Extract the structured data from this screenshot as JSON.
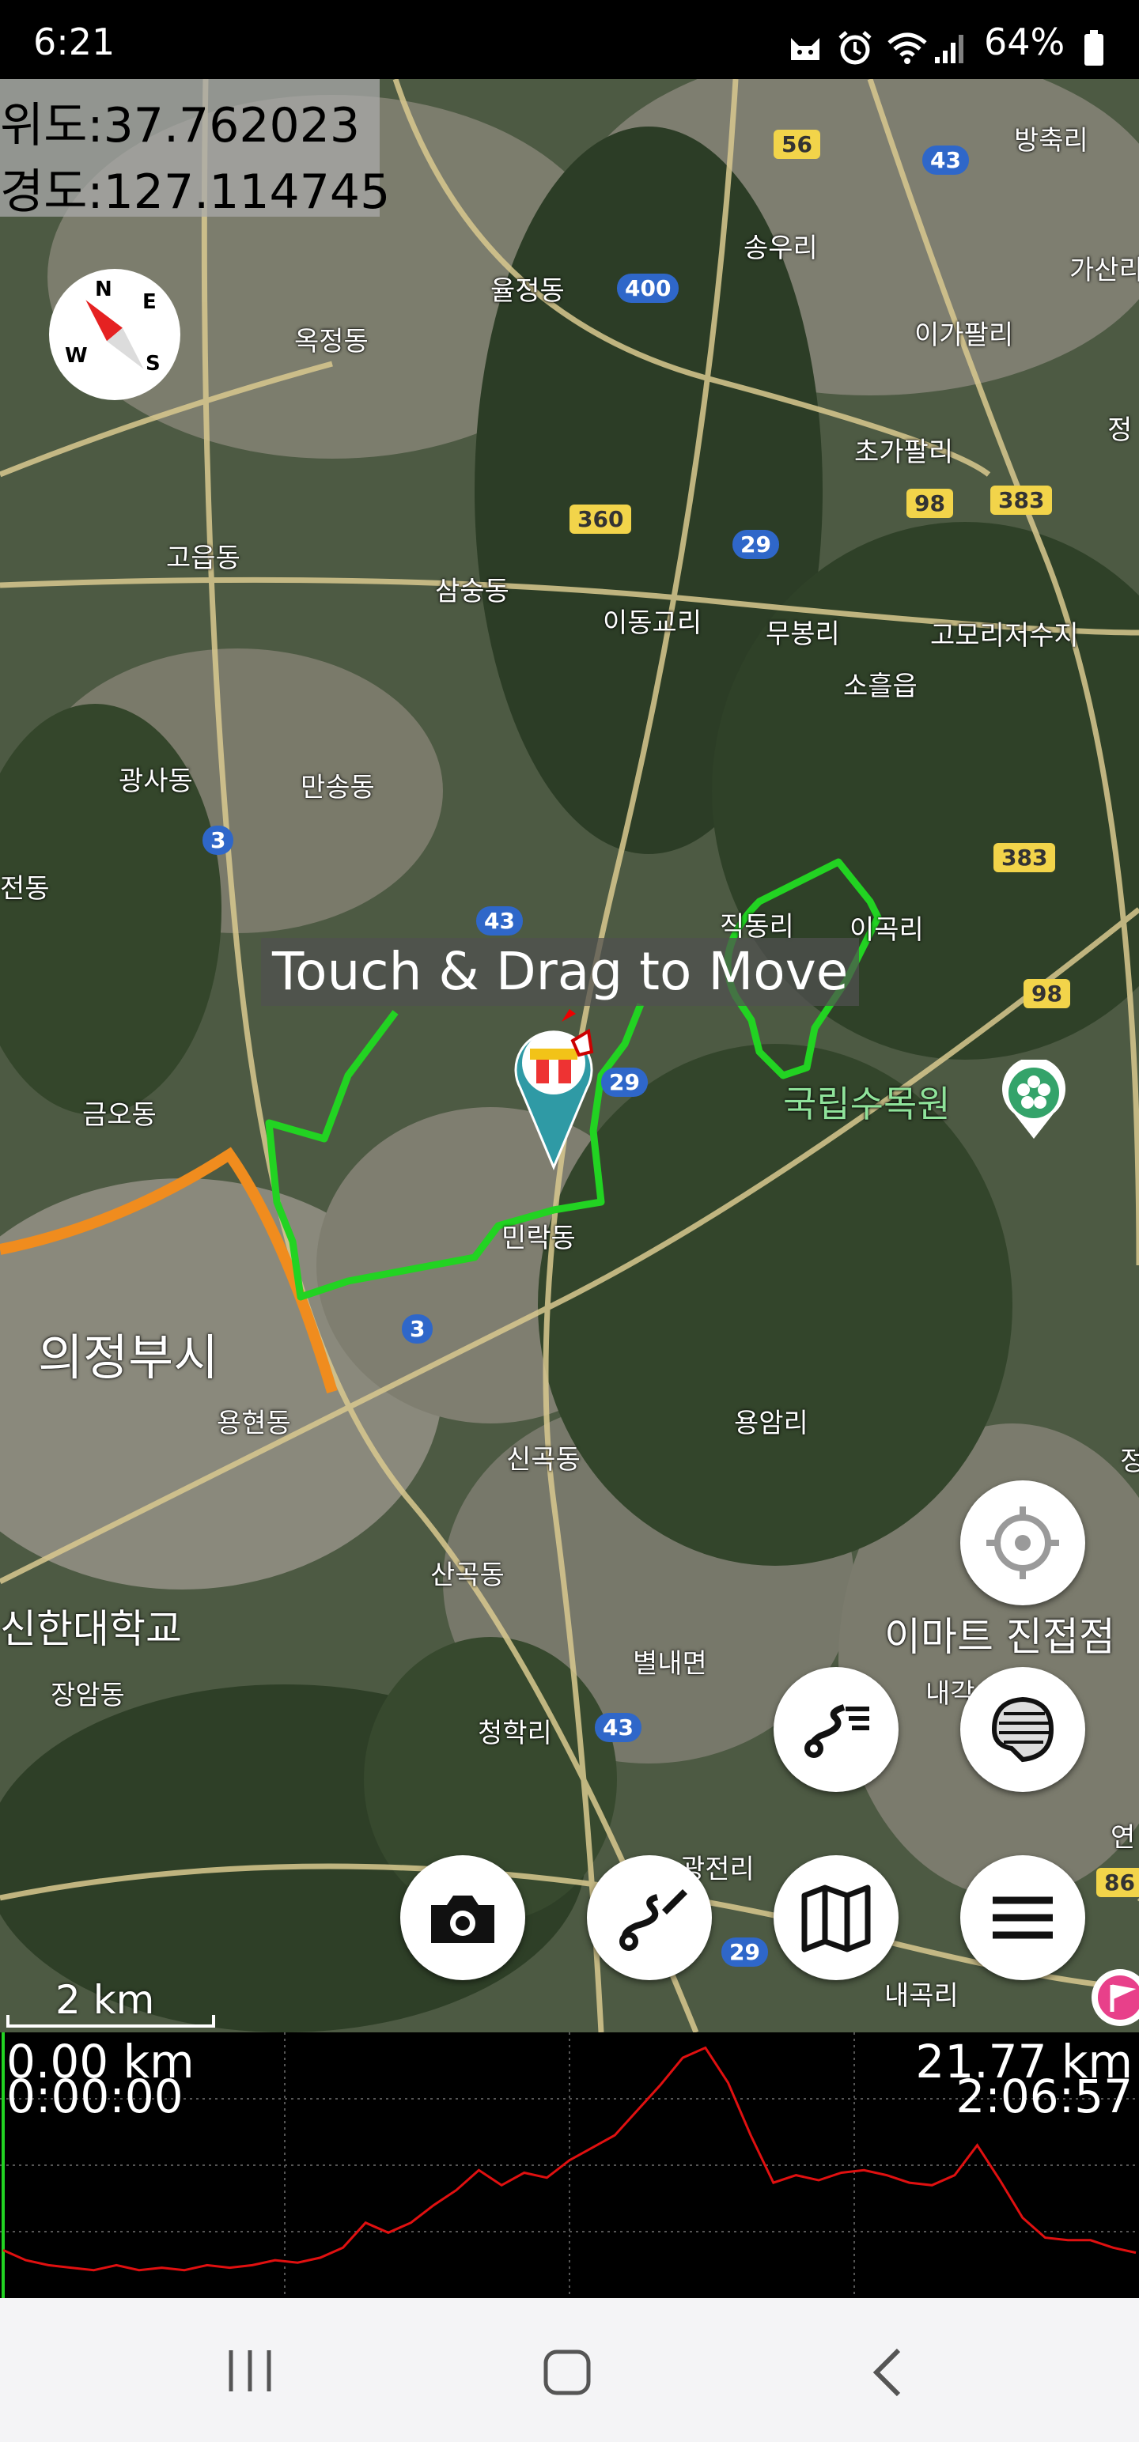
{
  "status_bar": {
    "time": "6:21",
    "battery_percent": "64%",
    "icons": [
      "cat-notification-icon",
      "alarm-icon",
      "wifi-icon",
      "signal-icon",
      "battery-icon"
    ]
  },
  "coordinates": {
    "latitude_text": "위도:37.762023",
    "longitude_text": "경도:127.114745"
  },
  "compass": {
    "north": "N",
    "east": "E",
    "south": "S",
    "west": "W"
  },
  "map": {
    "drag_hint": "Touch & Drag to Move",
    "place_labels": {
      "bangchukri": "방축리",
      "gasanri": "가산리",
      "yuljeongdong": "율정동",
      "songuri": "송우리",
      "okjeongdong": "옥정동",
      "igapalri": "이가팔리",
      "jeong": "정",
      "chogapalri": "초가팔리",
      "gosandong": "고읍동",
      "samsungdong": "삼숭동",
      "idonggyori": "이동교리",
      "mubongri": "무봉리",
      "gomorijeosuji": "고모리저수지",
      "soheulp": "소흘읍",
      "gwangsadong": "광사동",
      "mansongdong": "만송동",
      "jeondong": "전동",
      "jikdongri": "직동리",
      "igokri": "이곡리",
      "geumodong": "금오동",
      "arboretum": "국립수목원",
      "minrakdong": "민락동",
      "uijeongbu": "의정부시",
      "yonghyeondong": "용현동",
      "yongamri": "용암리",
      "singokdong": "신곡동",
      "sangokdong": "산곡동",
      "shinhan_univ": "신한대학교",
      "emart": "이마트 진접점",
      "naegak": "내각",
      "jangamdong": "장암동",
      "byeollaemyeon": "별내면",
      "cheonghakri": "청학리",
      "gwangjeonri": "광전리",
      "naegokri": "내곡리",
      "yeon": "연",
      "jeong2": "정"
    },
    "road_numbers": [
      "56",
      "43",
      "400",
      "360",
      "29",
      "98",
      "383",
      "3",
      "43",
      "383",
      "98",
      "29",
      "3",
      "43",
      "29",
      "86"
    ],
    "track_color": "#22d322",
    "road_highlight_color": "#f08c1e",
    "scale_label": "2 km"
  },
  "buttons": {
    "locate": "crosshair-icon",
    "route_list": "route-list-icon",
    "map_layer": "layer-icon",
    "camera": "camera-icon",
    "route_edit": "route-edit-icon",
    "map": "map-icon",
    "menu": "menu-icon"
  },
  "elevation_profile": {
    "start_distance": "0.00 km",
    "start_time": "0:00:00",
    "end_distance": "21.77 km",
    "end_time": "2:06:57",
    "line_color": "#e01010",
    "profile_fraction": [
      0.16,
      0.12,
      0.1,
      0.09,
      0.08,
      0.1,
      0.08,
      0.09,
      0.08,
      0.1,
      0.09,
      0.1,
      0.12,
      0.11,
      0.13,
      0.17,
      0.27,
      0.23,
      0.27,
      0.34,
      0.4,
      0.48,
      0.42,
      0.47,
      0.45,
      0.52,
      0.57,
      0.62,
      0.72,
      0.82,
      0.93,
      0.97,
      0.83,
      0.62,
      0.43,
      0.46,
      0.44,
      0.47,
      0.48,
      0.46,
      0.43,
      0.42,
      0.46,
      0.58,
      0.44,
      0.29,
      0.21,
      0.2,
      0.2,
      0.17,
      0.15
    ]
  },
  "nav_bar": {
    "recent": "recent-apps-icon",
    "home": "home-icon",
    "back": "back-icon"
  }
}
